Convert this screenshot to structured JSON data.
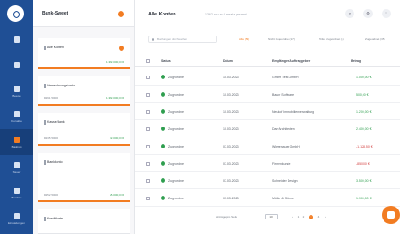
{
  "rail": {
    "items": [
      {
        "label": "",
        "icon": "home-icon"
      },
      {
        "label": "",
        "icon": "bank-icon"
      },
      {
        "label": "Belege",
        "icon": "document-icon"
      },
      {
        "label": "Kontakte",
        "icon": "contacts-icon"
      },
      {
        "label": "Banking",
        "icon": "banking-icon"
      },
      {
        "label": "Steuer",
        "icon": "tax-icon"
      },
      {
        "label": "Berichte",
        "icon": "chart-icon"
      },
      {
        "label": "Einstellungen",
        "icon": "settings-icon"
      }
    ]
  },
  "panel": {
    "title": "Bank-Sweet",
    "cards": [
      {
        "name": "Alle Konten",
        "meta_l": "",
        "meta_r": "1.362.000,00 €"
      },
      {
        "name": "Verrechnungskonto",
        "meta_l": "DE91 5000",
        "meta_r": "1.362.000,00 €"
      },
      {
        "name": "Kasse/Bank",
        "meta_l": "DE35 5000",
        "meta_r": "12.000,00 €"
      },
      {
        "name": "Bankkonto",
        "meta_l": "DE52 5000",
        "meta_r": "25.000,00 €"
      },
      {
        "name": "Kreditkarte",
        "meta_l": "",
        "meta_r": ""
      }
    ]
  },
  "main": {
    "title": "Alle Konten",
    "subtitle": "1362 neu zu Umsatz gesamt",
    "toolbar": {
      "search_placeholder": "Buchungen durchsuchen",
      "chips": [
        "Alle (53)",
        "Nicht zugeordnet (17)",
        "Teilw. zugeordnet (1)",
        "Zugeordnet (35)"
      ]
    },
    "columns": [
      "Status",
      "Datum",
      "Empfänger/Auftraggeber",
      "Betrag"
    ],
    "rows": [
      {
        "status": "Zugeordnet",
        "date": "10.03.2023",
        "party": "GmbH Test GmbH",
        "amount": "1.000,00 €",
        "amount_color": "#2f9e4f"
      },
      {
        "status": "Zugeordnet",
        "date": "10.03.2023",
        "party": "Bauer Software",
        "amount": "500,00 €",
        "amount_color": "#2f9e4f"
      },
      {
        "status": "Zugeordnet",
        "date": "10.03.2023",
        "party": "Neuhof Immobilienverwaltung",
        "amount": "1.200,00 €",
        "amount_color": "#2f9e4f"
      },
      {
        "status": "Zugeordnet",
        "date": "10.03.2023",
        "party": "Dan Architekten",
        "amount": "2.400,00 €",
        "amount_color": "#2f9e4f"
      },
      {
        "status": "Zugeordnet",
        "date": "07.03.2023",
        "party": "Wiesenauer GmbH",
        "amount": "-1.128,50 €",
        "amount_color": "#d13b3b"
      },
      {
        "status": "Zugeordnet",
        "date": "07.03.2023",
        "party": "Firmenkunde",
        "amount": "-850,00 €",
        "amount_color": "#d13b3b"
      },
      {
        "status": "Zugeordnet",
        "date": "07.03.2023",
        "party": "Schneider Design",
        "amount": "3.500,00 €",
        "amount_color": "#2f9e4f"
      },
      {
        "status": "Zugeordnet",
        "date": "07.03.2023",
        "party": "Müller & Söhne",
        "amount": "1.900,00 €",
        "amount_color": "#2f9e4f"
      }
    ],
    "pager": {
      "label": "Einträge pro Seite",
      "per_page": "10",
      "pages": [
        "1",
        "2",
        "3",
        "4"
      ],
      "active_page": "2"
    }
  },
  "colors": {
    "accent": "#f27c22",
    "rail": "#1f4f95",
    "positive": "#2f9e4f",
    "negative": "#d13b3b"
  }
}
